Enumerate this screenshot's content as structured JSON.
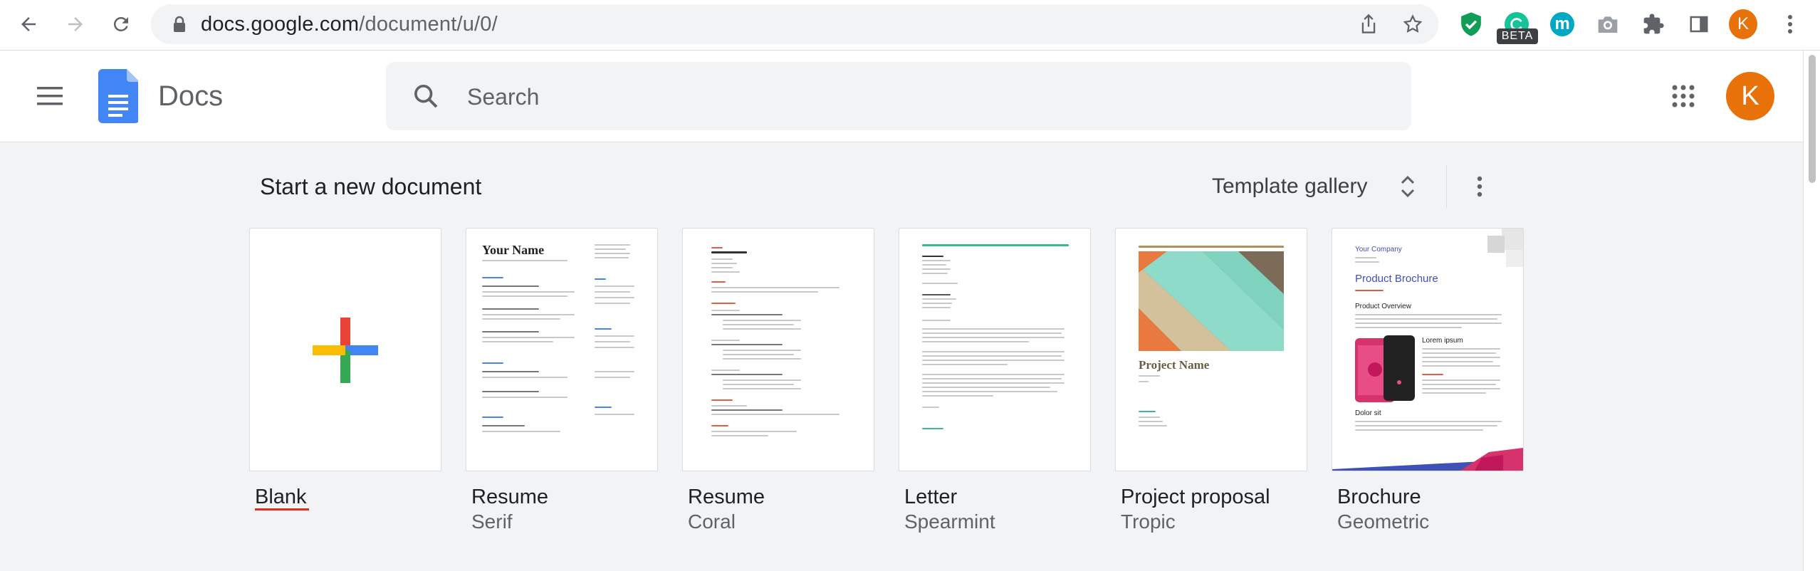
{
  "browser": {
    "url_host": "docs.google.com",
    "url_path": "/document/u/0/",
    "beta_badge": "BETA",
    "ext_m_letter": "m",
    "profile_letter": "K",
    "colors": {
      "profile": "#e8710a",
      "ext_shield": "#0f9d58",
      "ext_m": "#00a8c6"
    }
  },
  "header": {
    "app_title": "Docs",
    "search_placeholder": "Search",
    "account_letter": "K"
  },
  "templates_section": {
    "title": "Start a new document",
    "gallery_label": "Template gallery"
  },
  "templates": [
    {
      "name": "Blank",
      "sub": ""
    },
    {
      "name": "Resume",
      "sub": "Serif",
      "preview_title": "Your Name"
    },
    {
      "name": "Resume",
      "sub": "Coral"
    },
    {
      "name": "Letter",
      "sub": "Spearmint"
    },
    {
      "name": "Project proposal",
      "sub": "Tropic",
      "preview_title": "Project Name"
    },
    {
      "name": "Brochure",
      "sub": "Geometric",
      "preview_company": "Your Company",
      "preview_title": "Product Brochure",
      "preview_heading": "Product Overview",
      "preview_sub": "Lorem ipsum",
      "preview_sub2": "Dolor sit"
    }
  ]
}
